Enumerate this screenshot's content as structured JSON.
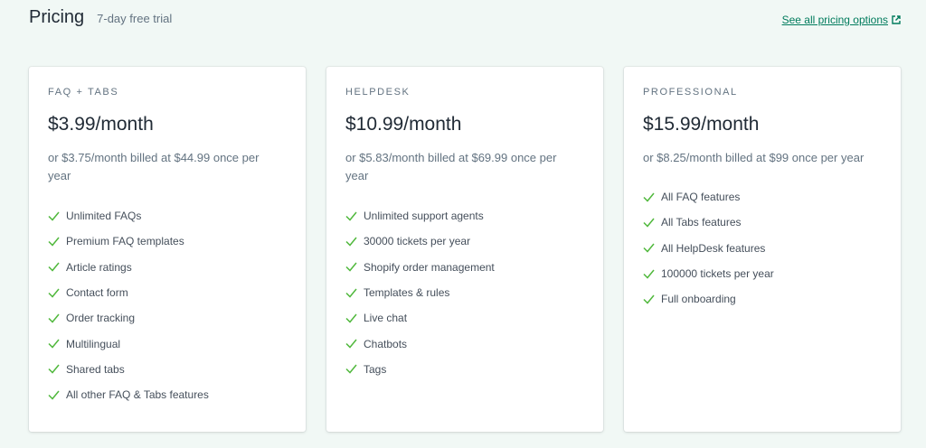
{
  "header": {
    "title": "Pricing",
    "trial": "7-day free trial",
    "see_all_link": "See all pricing options",
    "link_icon": "external-link-icon"
  },
  "colors": {
    "background": "#f1f8f5",
    "check": "#50b83c",
    "link": "#007b5c"
  },
  "plans": [
    {
      "name": "FAQ + TABS",
      "price": "$3.99/month",
      "billing": "or $3.75/month billed at $44.99 once per year",
      "features": [
        "Unlimited FAQs",
        "Premium FAQ templates",
        "Article ratings",
        "Contact form",
        "Order tracking",
        "Multilingual",
        "Shared tabs",
        "All other FAQ & Tabs features"
      ]
    },
    {
      "name": "HELPDESK",
      "price": "$10.99/month",
      "billing": "or $5.83/month billed at $69.99 once per year",
      "features": [
        "Unlimited support agents",
        "30000 tickets per year",
        "Shopify order management",
        "Templates & rules",
        "Live chat",
        "Chatbots",
        "Tags"
      ]
    },
    {
      "name": "PROFESSIONAL",
      "price": "$15.99/month",
      "billing": "or $8.25/month billed at $99 once per year",
      "features": [
        "All FAQ features",
        "All Tabs features",
        "All HelpDesk features",
        "100000 tickets per year",
        "Full onboarding"
      ]
    }
  ]
}
